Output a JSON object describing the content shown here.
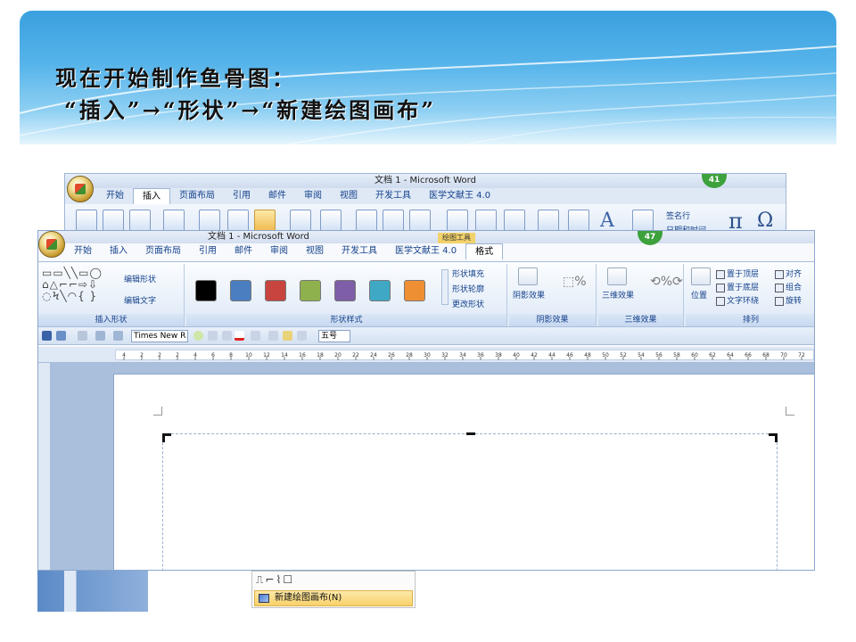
{
  "slide": {
    "heading_line1": "现在开始制作鱼骨图：",
    "heading_line2": "“插入”→“形状”→“新建绘图画布”"
  },
  "back_window": {
    "title": "文档 1 - Microsoft Word",
    "tabs": [
      "开始",
      "插入",
      "页面布局",
      "引用",
      "邮件",
      "审阅",
      "视图",
      "开发工具",
      "医学文献王 4.0"
    ],
    "active_tab": "插入",
    "badge": "41",
    "signature_label": "签名行",
    "datetime_label": "日期和时间"
  },
  "front_window": {
    "title": "文档 1 - Microsoft Word",
    "contextual_tag": "绘图工具",
    "tabs": [
      "开始",
      "插入",
      "页面布局",
      "引用",
      "邮件",
      "审阅",
      "视图",
      "开发工具",
      "医学文献王 4.0",
      "格式"
    ],
    "active_tab": "格式",
    "badge": "47",
    "groups": {
      "insert_shapes": {
        "label": "插入形状",
        "edit_shape": "编辑形状",
        "edit_text": "编辑文字",
        "shape_glyphs": "▭▭╲╲▭◯ ⌂△⌐⌐⇨⇩ ◌Ϟ╲◠{ }"
      },
      "shape_styles": {
        "label": "形状样式",
        "swatch_colors": [
          "#000000",
          "#4a7ec0",
          "#c8443f",
          "#8fb14d",
          "#7d5ea7",
          "#3fa8c4",
          "#ef8f34"
        ],
        "fill": "形状填充",
        "outline": "形状轮廓",
        "change_shape": "更改形状"
      },
      "shadow": {
        "label": "阴影效果",
        "button": "阴影效果"
      },
      "threed": {
        "label": "三维效果",
        "button": "三维效果"
      },
      "arrange": {
        "label": "排列",
        "position": "位置",
        "bring_front": "置于顶层",
        "send_back": "置于底层",
        "text_wrap": "文字环绕",
        "align": "对齐",
        "group": "组合",
        "rotate": "旋转"
      }
    },
    "toolbar": {
      "font": "Times New R",
      "size": "五号"
    },
    "ruler_ticks": [
      "4",
      "2",
      "2",
      "2",
      "4",
      "6",
      "8",
      "10",
      "12",
      "14",
      "16",
      "18",
      "20",
      "22",
      "24",
      "26",
      "28",
      "30",
      "32",
      "34",
      "36",
      "38",
      "40",
      "42",
      "44",
      "46",
      "48",
      "50",
      "52",
      "54",
      "56",
      "58",
      "60",
      "62",
      "64",
      "66",
      "68",
      "70",
      "72"
    ]
  },
  "dropdown_menu": {
    "item": "新建绘图画布(N)"
  }
}
